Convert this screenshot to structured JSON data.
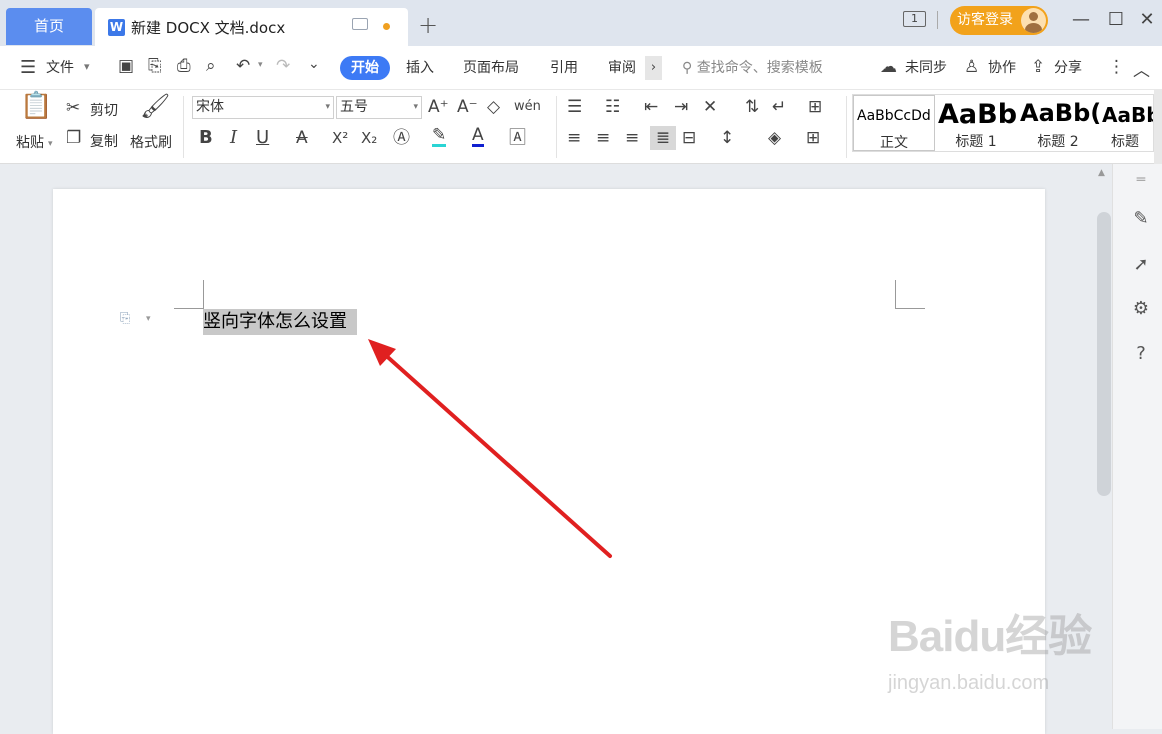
{
  "titlebar": {
    "home_tab": "首页",
    "doc_icon": "W",
    "doc_tab": "新建 DOCX 文档.docx",
    "new_tab_glyph": "+",
    "window_count": "1",
    "login_label": "访客登录",
    "minimize_glyph": "—",
    "maximize_glyph": "☐",
    "close_glyph": "✕"
  },
  "menubar": {
    "file_label": "文件",
    "tabs": [
      "开始",
      "插入",
      "页面布局",
      "引用",
      "审阅"
    ],
    "more_glyph": "›",
    "search_placeholder": "查找命令、搜索模板",
    "unsync_label": "未同步",
    "collab_label": "协作",
    "share_label": "分享"
  },
  "ribbon": {
    "paste_label": "粘贴",
    "cut_label": "剪切",
    "copy_label": "复制",
    "format_painter_label": "格式刷",
    "font_name": "宋体",
    "font_size": "五号",
    "pinyin_label": "wén",
    "bold": "B",
    "italic": "I",
    "underline": "U",
    "superscript": "X²",
    "subscript": "X₂",
    "font_color_glyph": "A",
    "grow_font": "A⁺",
    "shrink_font": "A⁻",
    "styles": [
      {
        "sample": "AaBbCcDd",
        "name": "正文"
      },
      {
        "sample": "AaBb",
        "name": "标题 1"
      },
      {
        "sample": "AaBb(",
        "name": "标题 2"
      },
      {
        "sample": "AaBb",
        "name": "标题"
      }
    ]
  },
  "document": {
    "text": "竖向字体怎么设置"
  },
  "watermark": {
    "main": "Baidu经验",
    "sub": "jingyan.baidu.com"
  },
  "colors": {
    "accent": "#3d7af5",
    "home_tab": "#5b8def",
    "login": "#f2a21b",
    "arrow": "#e02020",
    "selection": "#c8c8c8"
  }
}
